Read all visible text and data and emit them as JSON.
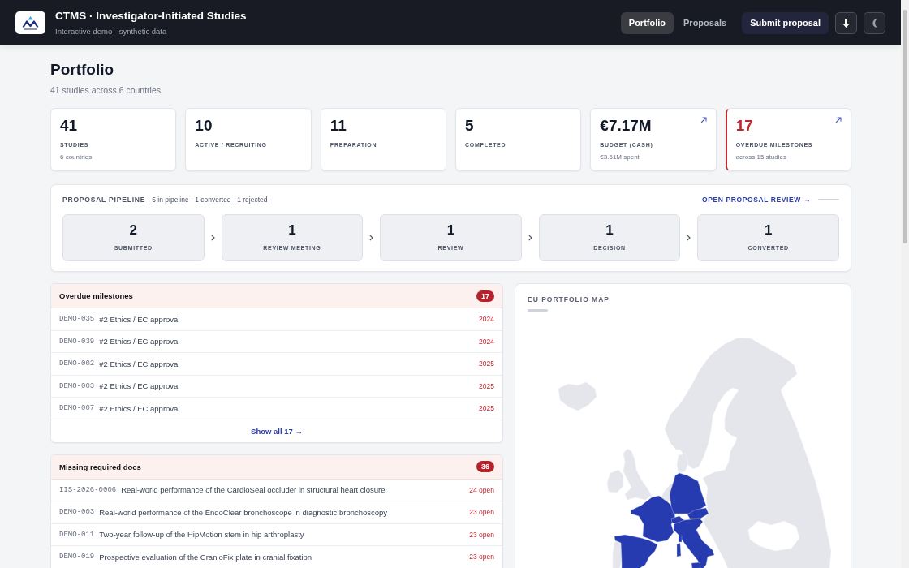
{
  "header": {
    "title": "CTMS · Investigator-Initiated Studies",
    "subtitle": "Interactive demo · synthetic data",
    "nav": [
      {
        "label": "Portfolio",
        "selected": true
      },
      {
        "label": "Proposals",
        "selected": false
      }
    ],
    "action": "Submit proposal"
  },
  "page": {
    "title": "Portfolio",
    "subtitle": "41 studies across 6 countries"
  },
  "stats": [
    {
      "value": "41",
      "label": "STUDIES",
      "note": "6 countries",
      "link": false,
      "alert": false
    },
    {
      "value": "10",
      "label": "ACTIVE / RECRUITING",
      "link": false,
      "alert": false
    },
    {
      "value": "11",
      "label": "PREPARATION",
      "link": false,
      "alert": false
    },
    {
      "value": "5",
      "label": "COMPLETED",
      "link": false,
      "alert": false
    },
    {
      "value": "€7.17M",
      "label": "BUDGET (CASH)",
      "note": "€3.61M spent",
      "link": true,
      "alert": false
    },
    {
      "value": "17",
      "label": "OVERDUE MILESTONES",
      "note": "across 15 studies",
      "link": true,
      "alert": true
    }
  ],
  "pipeline": {
    "title": "PROPOSAL PIPELINE",
    "summary": "5 in pipeline · 1 converted · 1 rejected",
    "link": "OPEN PROPOSAL REVIEW →",
    "stages": [
      {
        "count": "2",
        "label": "SUBMITTED"
      },
      {
        "count": "1",
        "label": "REVIEW MEETING"
      },
      {
        "count": "1",
        "label": "REVIEW"
      },
      {
        "count": "1",
        "label": "DECISION"
      },
      {
        "count": "1",
        "label": "CONVERTED"
      }
    ]
  },
  "overdue_milestones": {
    "title": "Overdue milestones",
    "count": "17",
    "rows": [
      {
        "id": "DEMO-035",
        "title": "#2 Ethics / EC approval",
        "due": "2024"
      },
      {
        "id": "DEMO-039",
        "title": "#2 Ethics / EC approval",
        "due": "2024"
      },
      {
        "id": "DEMO-002",
        "title": "#2 Ethics / EC approval",
        "due": "2025"
      },
      {
        "id": "DEMO-003",
        "title": "#2 Ethics / EC approval",
        "due": "2025"
      },
      {
        "id": "DEMO-007",
        "title": "#2 Ethics / EC approval",
        "due": "2025"
      }
    ],
    "show_all": "Show all 17 →"
  },
  "missing_docs": {
    "title": "Missing required docs",
    "count": "36",
    "rows": [
      {
        "id": "IIS-2026-0006",
        "title": "Real-world performance of the CardioSeal occluder in structural heart closure",
        "open": "24 open"
      },
      {
        "id": "DEMO-003",
        "title": "Real-world performance of the EndoClear bronchoscope in diagnostic bronchoscopy",
        "open": "23 open"
      },
      {
        "id": "DEMO-011",
        "title": "Two-year follow-up of the HipMotion stem in hip arthroplasty",
        "open": "23 open"
      },
      {
        "id": "DEMO-019",
        "title": "Prospective evaluation of the CranioFix plate in cranial fixation",
        "open": "23 open"
      }
    ]
  },
  "map": {
    "title": "EU PORTFOLIO MAP"
  }
}
